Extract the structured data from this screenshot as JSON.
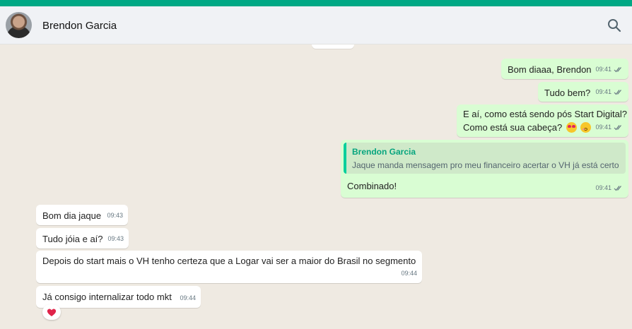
{
  "header": {
    "contact_name": "Brendon Garcia",
    "search_icon": "search-icon",
    "accent": "#00a884"
  },
  "colors": {
    "outgoing_bubble": "#d9fdd3",
    "incoming_bubble": "#ffffff",
    "chat_background": "#efeae2",
    "quote_author": "#06a57e"
  },
  "messages": [
    {
      "direction": "out",
      "text": "Bom diaaa, Brendon",
      "time": "09:41",
      "status": "read-ticks"
    },
    {
      "direction": "out",
      "text": "Tudo bem?",
      "time": "09:41",
      "status": "read-ticks"
    },
    {
      "direction": "out",
      "line1": "E aí, como está sendo pós Start Digital?",
      "line2": "Como está sua cabeça?",
      "emojis": [
        "heart-eyes-emoji",
        "kissing-emoji"
      ],
      "time": "09:41",
      "status": "read-ticks"
    },
    {
      "direction": "out",
      "quote_author": "Brendon Garcia",
      "quote_text": "Jaque manda mensagem pro meu financeiro acertar o VH já está certo",
      "text": "Combinado!",
      "time": "09:41",
      "status": "read-ticks"
    },
    {
      "direction": "in",
      "text": "Bom dia jaque",
      "time": "09:43"
    },
    {
      "direction": "in",
      "text": "Tudo jóia e aí?",
      "time": "09:43"
    },
    {
      "direction": "in",
      "text": "Depois do start mais o VH tenho certeza que a Logar vai ser a maior do Brasil no segmento",
      "time": "09:44"
    },
    {
      "direction": "in",
      "text": "Já consigo internalizar todo mkt",
      "time": "09:44",
      "reaction": "red-heart-emoji"
    }
  ]
}
